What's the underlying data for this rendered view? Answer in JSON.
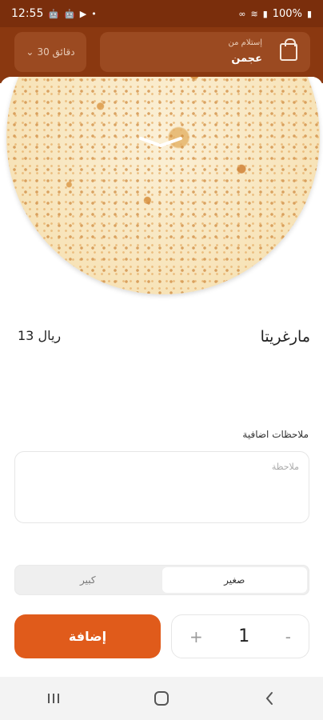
{
  "status_bar": {
    "time": "12:55",
    "battery": "100%"
  },
  "header": {
    "eta": "30 دقائق",
    "pickup_label": "إستلام من",
    "pickup_value": "عجمن"
  },
  "product": {
    "name": "مارغريتا",
    "price": "13 ريال"
  },
  "notes": {
    "label": "ملاحظات اضافية",
    "placeholder": "ملاحظة"
  },
  "size": {
    "options": [
      "صغير",
      "كبير"
    ],
    "selected": "صغير"
  },
  "cart": {
    "add_label": "إضافة",
    "quantity": "1",
    "plus": "+",
    "minus": "-"
  },
  "colors": {
    "primary": "#e05b1b",
    "header": "#8a3810",
    "status_bar": "#7a2e0c"
  }
}
